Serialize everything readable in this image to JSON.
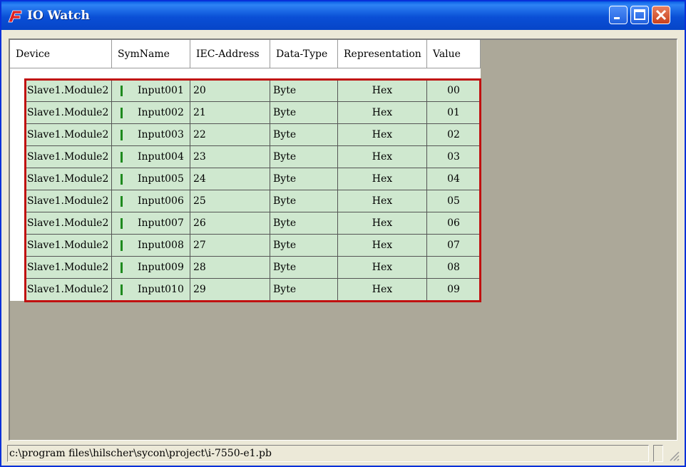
{
  "window": {
    "title": "IO Watch"
  },
  "table": {
    "columns": [
      "Device",
      "SymName",
      "IEC-Address",
      "Data-Type",
      "Representation",
      "Value"
    ],
    "rows": [
      [
        "Slave1.Module2",
        "Input001",
        "20",
        "Byte",
        "Hex",
        "00"
      ],
      [
        "Slave1.Module2",
        "Input002",
        "21",
        "Byte",
        "Hex",
        "01"
      ],
      [
        "Slave1.Module2",
        "Input003",
        "22",
        "Byte",
        "Hex",
        "02"
      ],
      [
        "Slave1.Module2",
        "Input004",
        "23",
        "Byte",
        "Hex",
        "03"
      ],
      [
        "Slave1.Module2",
        "Input005",
        "24",
        "Byte",
        "Hex",
        "04"
      ],
      [
        "Slave1.Module2",
        "Input006",
        "25",
        "Byte",
        "Hex",
        "05"
      ],
      [
        "Slave1.Module2",
        "Input007",
        "26",
        "Byte",
        "Hex",
        "06"
      ],
      [
        "Slave1.Module2",
        "Input008",
        "27",
        "Byte",
        "Hex",
        "07"
      ],
      [
        "Slave1.Module2",
        "Input009",
        "28",
        "Byte",
        "Hex",
        "08"
      ],
      [
        "Slave1.Module2",
        "Input010",
        "29",
        "Byte",
        "Hex",
        "09"
      ]
    ],
    "row_color": "#cfe8cf",
    "indicator_color": "#1e8a1e",
    "highlight_color": "#c01010"
  },
  "statusbar": {
    "path": "c:\\program files\\hilscher\\sycon\\project\\i-7550-e1.pb"
  },
  "icons": [
    "app-icon",
    "minimize-icon",
    "maximize-icon",
    "close-icon",
    "resize-grip-icon"
  ]
}
